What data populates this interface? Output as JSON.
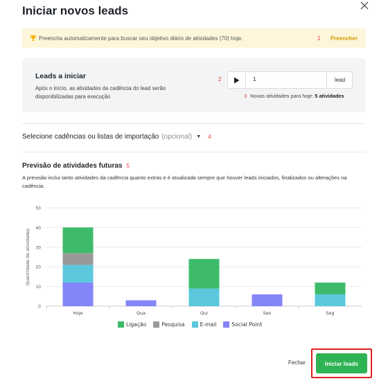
{
  "modal": {
    "title": "Iniciar novos leads",
    "close_icon": "close-icon"
  },
  "hint": {
    "icon": "trophy-icon",
    "text": "Preencha automaticamente para buscar seu objetivo diário de atividades (70) hoje.",
    "step": "1",
    "action_label": "Preencher",
    "accent": "#d99a00"
  },
  "leads": {
    "title": "Leads a iniciar",
    "description": "Após o início, as atividades da cadência do lead serão disponibilizadas para execução",
    "step": "2",
    "quantity": "1",
    "unit": "lead",
    "play_icon": "play-icon",
    "new_activities_step": "3",
    "new_activities_label": "Novas atividades para hoje:",
    "new_activities_value": "5 atividades"
  },
  "cadence": {
    "label": "Selecione cadências ou listas de importação",
    "optional": "(opcional)",
    "caret_icon": "caret-down-icon",
    "step": "4"
  },
  "forecast": {
    "title": "Previsão de atividades futuras",
    "step": "5",
    "description": "A previsão inclui tanto atividades da cadência quanto extras e é atualizada sempre que houver leads iniciados, finalizados ou alterações na cadência."
  },
  "chart_data": {
    "type": "bar",
    "stacked": true,
    "categories": [
      "Hoje",
      "Qua",
      "Qui",
      "Sex",
      "Seg"
    ],
    "ylabel": "Quantidade de atividades",
    "ylim": [
      0,
      50
    ],
    "yticks": [
      0,
      10,
      20,
      30,
      40,
      50
    ],
    "grid": true,
    "legend": "bottom",
    "series": [
      {
        "name": "Social Point",
        "color": "#8585fa",
        "values": [
          12,
          3,
          0,
          6,
          0
        ]
      },
      {
        "name": "E-mail",
        "color": "#5bc8dc",
        "values": [
          9,
          0,
          9,
          0,
          6
        ]
      },
      {
        "name": "Pesquisa",
        "color": "#999999",
        "values": [
          6,
          0,
          0,
          0,
          0
        ]
      },
      {
        "name": "Ligação",
        "color": "#3dbb6a",
        "values": [
          13,
          0,
          15,
          0,
          6
        ]
      }
    ],
    "legend_order": [
      "Ligação",
      "Pesquisa",
      "E-mail",
      "Social Point"
    ]
  },
  "footer": {
    "close_label": "Fechar",
    "primary_label": "Iniciar leads",
    "primary_color": "#2fb454"
  }
}
